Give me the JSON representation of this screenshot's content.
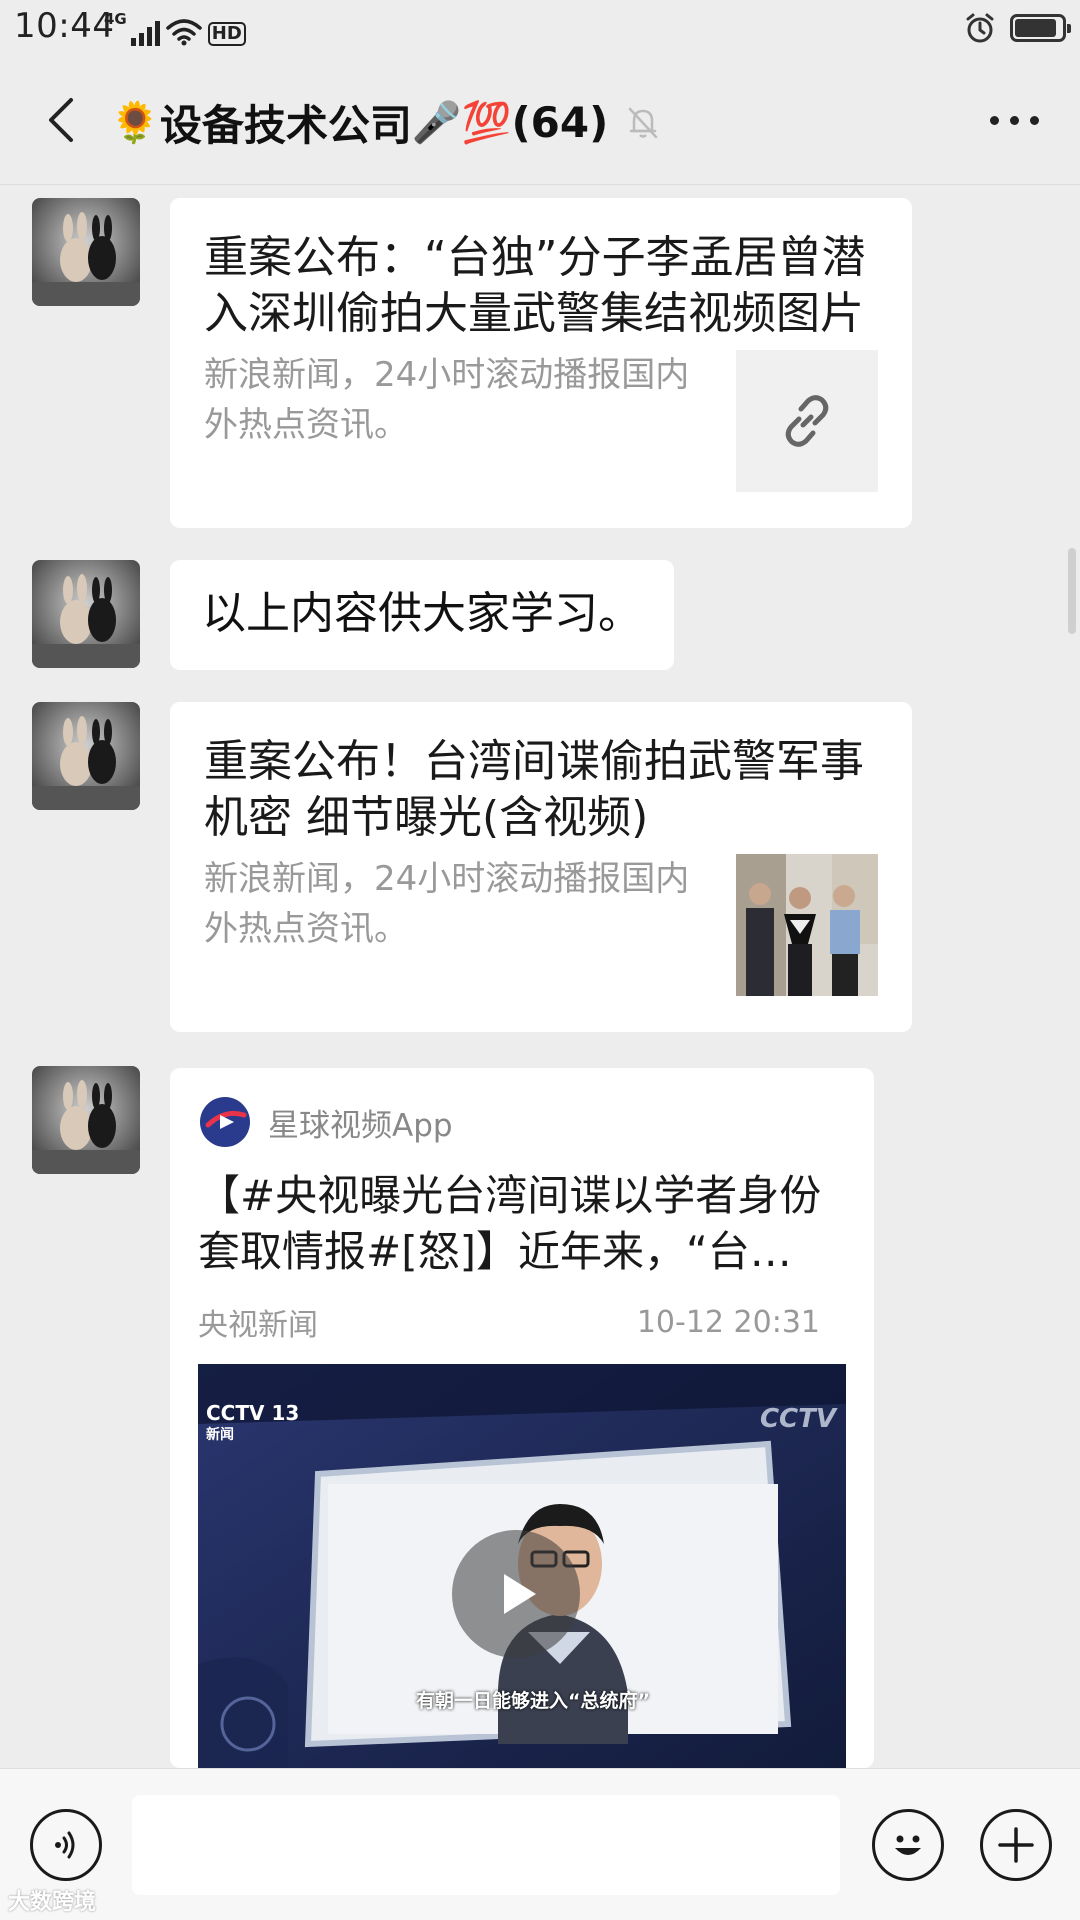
{
  "status_bar": {
    "time": "10:44",
    "network": "4G",
    "hd": "HD",
    "battery_level": 0.9
  },
  "header": {
    "emoji_leading": "🌻",
    "group_name": "设备技术公司",
    "emoji_trailing": "🎤💯",
    "member_count": "(64)"
  },
  "messages": [
    {
      "type": "link",
      "title": "重案公布：“台独”分子李孟居曾潜入深圳偷拍大量武警集结视频图片",
      "description": "新浪新闻，24小时滚动播报国内外热点资讯。",
      "thumbnail_icon": "link-icon"
    },
    {
      "type": "text",
      "text": "以上内容供大家学习。"
    },
    {
      "type": "link",
      "title": "重案公布！台湾间谍偷拍武警军事机密 细节曝光(含视频)",
      "description": "新浪新闻，24小时滚动播报国内外热点资讯。",
      "thumbnail_icon": "photo-thumbnail"
    },
    {
      "type": "video",
      "source_app": "星球视频App",
      "title": "【#央视曝光台湾间谍以学者身份套取情报#[怒]】近年来，“台…",
      "publisher": "央视新闻",
      "timestamp": "10-12 20:31",
      "channel_logo": "CCTV 13",
      "channel_sub": "新闻",
      "brand_logo": "CCTV",
      "caption": "有朝一日能够进入“总统府”"
    }
  ],
  "input_bar": {
    "placeholder": ""
  },
  "watermark": "大数跨境",
  "colors": {
    "background": "#ededed",
    "bubble": "#ffffff",
    "secondary_text": "#999999",
    "video_bg": "#1b2446"
  }
}
